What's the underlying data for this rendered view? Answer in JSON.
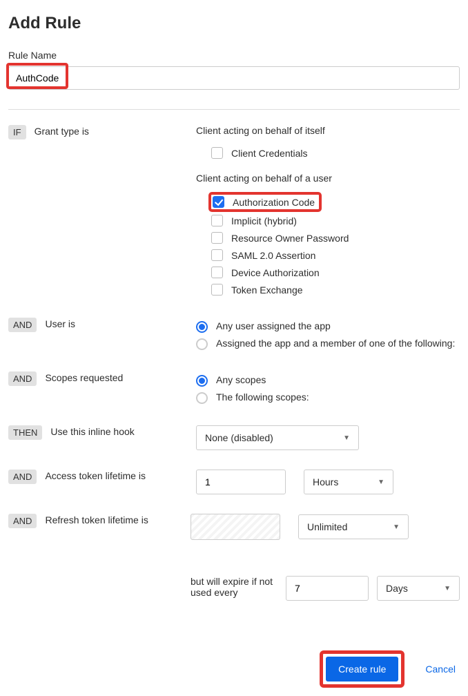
{
  "title": "Add Rule",
  "ruleNameLabel": "Rule Name",
  "ruleNameValue": "AuthCode",
  "tags": {
    "if": "IF",
    "and": "AND",
    "then": "THEN"
  },
  "labels": {
    "grantType": "Grant type is",
    "userIs": "User is",
    "scopes": "Scopes requested",
    "inlineHook": "Use this inline hook",
    "accessLifetime": "Access token lifetime is",
    "refreshLifetime": "Refresh token lifetime is"
  },
  "grantSections": {
    "itself": "Client acting on behalf of itself",
    "user": "Client acting on behalf of a user"
  },
  "grantOptions": {
    "clientCredentials": "Client Credentials",
    "authCode": "Authorization Code",
    "implicit": "Implicit (hybrid)",
    "resourceOwner": "Resource Owner Password",
    "saml": "SAML 2.0 Assertion",
    "deviceAuth": "Device Authorization",
    "tokenExchange": "Token Exchange"
  },
  "userOptions": {
    "any": "Any user assigned the app",
    "member": "Assigned the app and a member of one of the following:"
  },
  "scopeOptions": {
    "any": "Any scopes",
    "following": "The following scopes:"
  },
  "inlineHook": {
    "value": "None (disabled)"
  },
  "accessToken": {
    "value": "1",
    "unit": "Hours"
  },
  "refreshToken": {
    "unit": "Unlimited"
  },
  "expire": {
    "prefix": "but will expire if not used every",
    "value": "7",
    "unit": "Days"
  },
  "buttons": {
    "create": "Create rule",
    "cancel": "Cancel"
  }
}
